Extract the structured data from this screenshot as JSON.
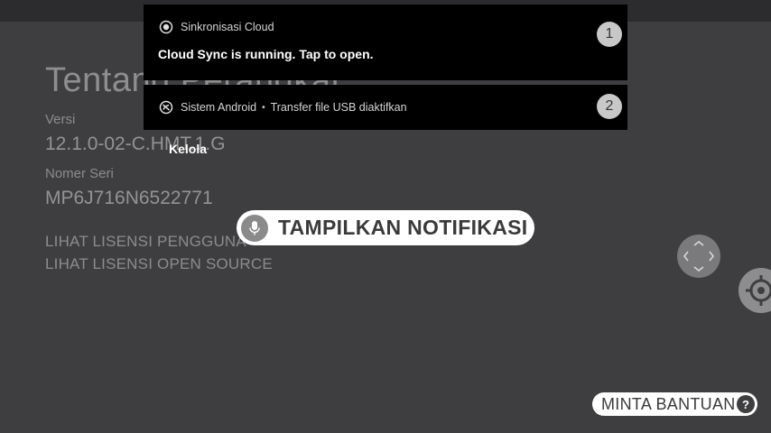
{
  "background_page": {
    "title": "Tentang Perangkat",
    "version_label": "Versi",
    "version_value": "12.1.0-02-C.HMT.1.G",
    "serial_label": "Nomer Seri",
    "serial_value": "MP6J716N6522771",
    "license_user_label": "LIHAT LISENSI PENGGUNA",
    "license_open_source_label": "LIHAT LISENSI OPEN SOURCE"
  },
  "notifications": [
    {
      "app_name": "Sinkronisasi Cloud",
      "body": "Cloud Sync is running. Tap to open.",
      "badge": "1",
      "icon": "cloud-sync-icon"
    },
    {
      "app_name": "Sistem Android",
      "separator": "•",
      "body": "Transfer file USB diaktifkan",
      "badge": "2",
      "icon": "android-system-icon"
    }
  ],
  "manage_label": "Kelola",
  "voice_command": {
    "label": "TAMPILKAN NOTIFIKASI",
    "icon": "mic-icon"
  },
  "help": {
    "label": "MINTA BANTUAN",
    "icon_glyph": "?"
  },
  "colors": {
    "background": "#3e3e40",
    "notification_bg": "#000000",
    "pill_bg": "#ffffff"
  }
}
